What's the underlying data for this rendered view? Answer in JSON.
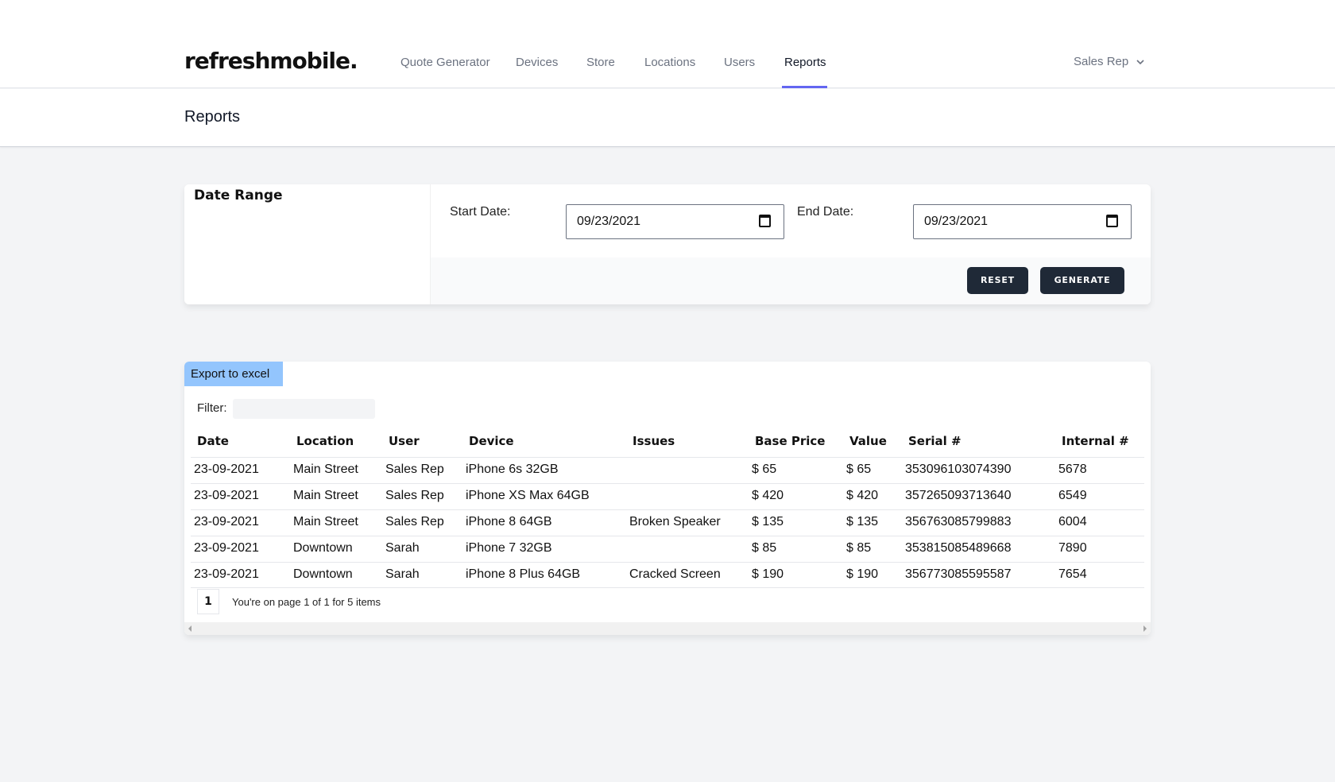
{
  "brand": {
    "logo": "refreshmobile."
  },
  "nav": {
    "items": [
      {
        "label": "Quote Generator"
      },
      {
        "label": "Devices"
      },
      {
        "label": "Store"
      },
      {
        "label": "Locations"
      },
      {
        "label": "Users"
      },
      {
        "label": "Reports",
        "active": true
      }
    ],
    "user_menu": "Sales Rep",
    "accent_color": "#6366f1"
  },
  "page": {
    "title": "Reports"
  },
  "date_range": {
    "heading": "Date Range",
    "start_label": "Start Date:",
    "start_value": "09/23/2021",
    "end_label": "End Date:",
    "end_value": "09/23/2021",
    "reset_label": "RESET",
    "generate_label": "GENERATE",
    "button_color": "#1f2937"
  },
  "report": {
    "export_label": "Export to excel",
    "export_color": "#93c5fd",
    "filter_label": "Filter:",
    "filter_value": "",
    "columns": [
      "Date",
      "Location",
      "User",
      "Device",
      "Issues",
      "Base Price",
      "Value",
      "Serial #",
      "Internal #"
    ],
    "rows": [
      [
        "23-09-2021",
        "Main Street",
        "Sales Rep",
        "iPhone 6s 32GB",
        "",
        "$ 65",
        "$ 65",
        "353096103074390",
        "5678"
      ],
      [
        "23-09-2021",
        "Main Street",
        "Sales Rep",
        "iPhone XS Max 64GB",
        "",
        "$ 420",
        "$ 420",
        "357265093713640",
        "6549"
      ],
      [
        "23-09-2021",
        "Main Street",
        "Sales Rep",
        "iPhone 8 64GB",
        "Broken Speaker",
        "$ 135",
        "$ 135",
        "356763085799883",
        "6004"
      ],
      [
        "23-09-2021",
        "Downtown",
        "Sarah",
        "iPhone 7 32GB",
        "",
        "$ 85",
        "$ 85",
        "353815085489668",
        "7890"
      ],
      [
        "23-09-2021",
        "Downtown",
        "Sarah",
        "iPhone 8 Plus 64GB",
        "Cracked Screen",
        "$ 190",
        "$ 190",
        "356773085595587",
        "7654"
      ]
    ],
    "pager": {
      "current_page": "1",
      "summary": "You're on page 1 of 1 for 5 items"
    }
  }
}
